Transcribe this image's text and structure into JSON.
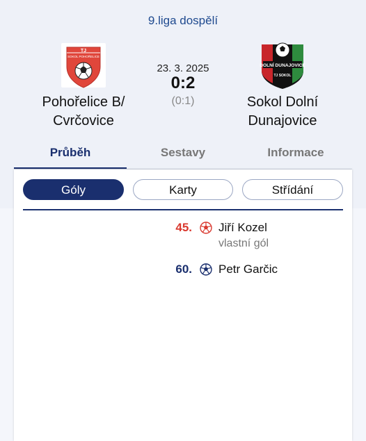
{
  "league": "9.liga dospělí",
  "home_team": {
    "name_line1": "Pohořelice B/",
    "name_line2": "Cvrčovice",
    "crest_text_top": "TJ",
    "crest_text_arc": "SOKOL POHOŘELICE"
  },
  "away_team": {
    "name_line1": "Sokol Dolní",
    "name_line2": "Dunajovice",
    "crest_text_main": "DOLNÍ DUNAJOVICE",
    "crest_text_bottom": "TJ SOKOL"
  },
  "match": {
    "date": "23. 3. 2025",
    "score": "0:2",
    "halftime": "(0:1)"
  },
  "tabs": [
    {
      "label": "Průběh",
      "active": true
    },
    {
      "label": "Sestavy",
      "active": false
    },
    {
      "label": "Informace",
      "active": false
    }
  ],
  "filters": [
    {
      "label": "Góly",
      "active": true
    },
    {
      "label": "Karty",
      "active": false
    },
    {
      "label": "Střídání",
      "active": false
    }
  ],
  "events": [
    {
      "minute": "45.",
      "player": "Jiří Kozel",
      "note": "vlastní gól",
      "type": "own-goal",
      "color": "#d9392f"
    },
    {
      "minute": "60.",
      "player": "Petr Garčic",
      "note": "",
      "type": "goal",
      "color": "#1a2f6e"
    }
  ],
  "colors": {
    "accent": "#1a2f6e",
    "own_goal": "#d9392f",
    "league_text": "#1f4a8f"
  }
}
